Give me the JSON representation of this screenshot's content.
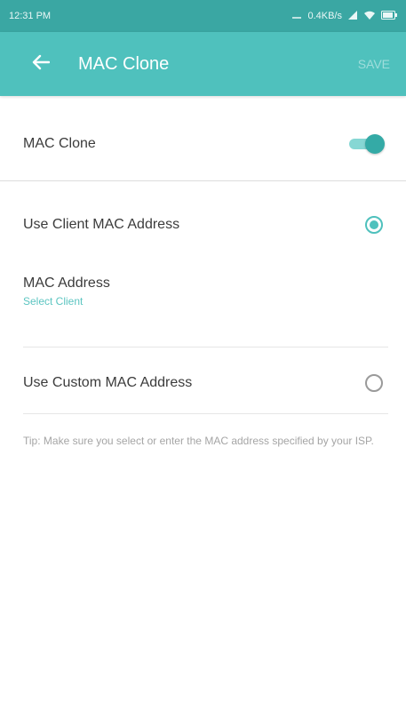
{
  "status_bar": {
    "time": "12:31 PM",
    "speed": "0.4KB/s",
    "icons": [
      "alarm-icon",
      "signal-icon",
      "wifi-icon",
      "battery-icon"
    ]
  },
  "app_bar": {
    "title": "MAC Clone",
    "save_label": "SAVE",
    "back_icon": "arrow-left-icon"
  },
  "mac_clone_row": {
    "label": "MAC Clone",
    "enabled": true
  },
  "options": {
    "client": {
      "label": "Use Client MAC Address",
      "selected": true,
      "mac_label": "MAC Address",
      "select_client": "Select Client"
    },
    "custom": {
      "label": "Use Custom MAC Address",
      "selected": false
    }
  },
  "tip": "Tip: Make sure you select or enter the MAC address specified by your ISP.",
  "colors": {
    "accent": "#4fc1bd",
    "status_bar": "#3aa7a3",
    "tip_text": "#a5a5a5"
  }
}
